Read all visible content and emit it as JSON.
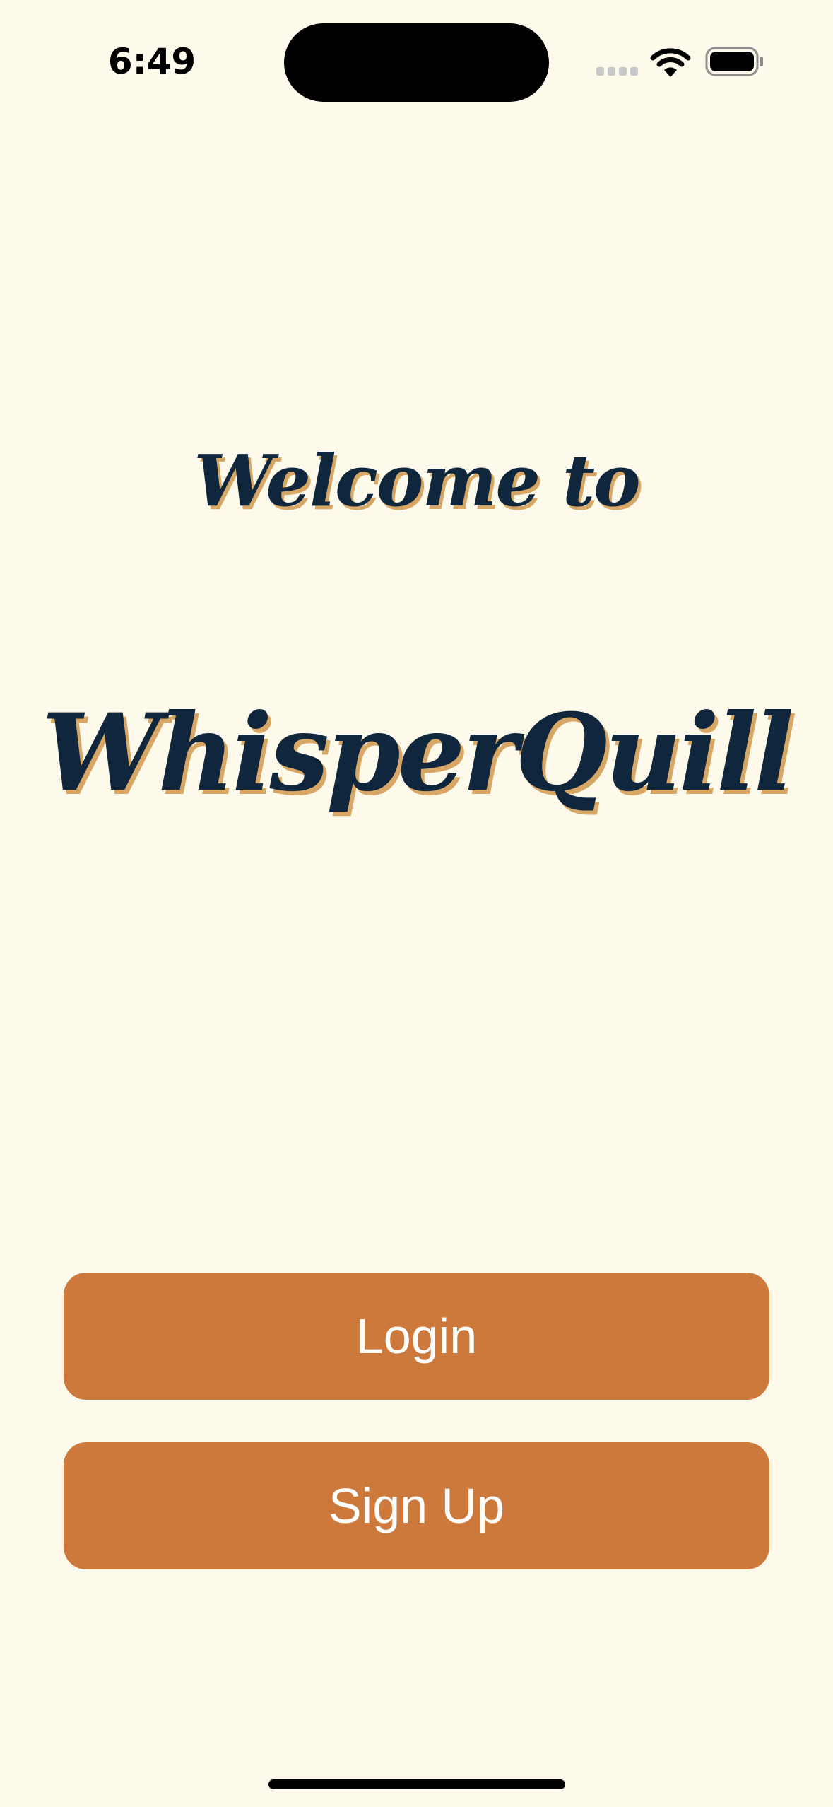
{
  "status_bar": {
    "time": "6:49",
    "icons": [
      "cellular-signal-icon",
      "wifi-icon",
      "battery-icon"
    ]
  },
  "welcome": {
    "line1": "Welcome to",
    "app_name": "WhisperQuill"
  },
  "actions": {
    "login_label": "Login",
    "signup_label": "Sign Up"
  },
  "colors": {
    "background": "#FDFAEB",
    "title_text": "#10263D",
    "title_shadow": "#D8A765",
    "button_fill": "#CE793C",
    "button_text": "#FFFFFF"
  }
}
